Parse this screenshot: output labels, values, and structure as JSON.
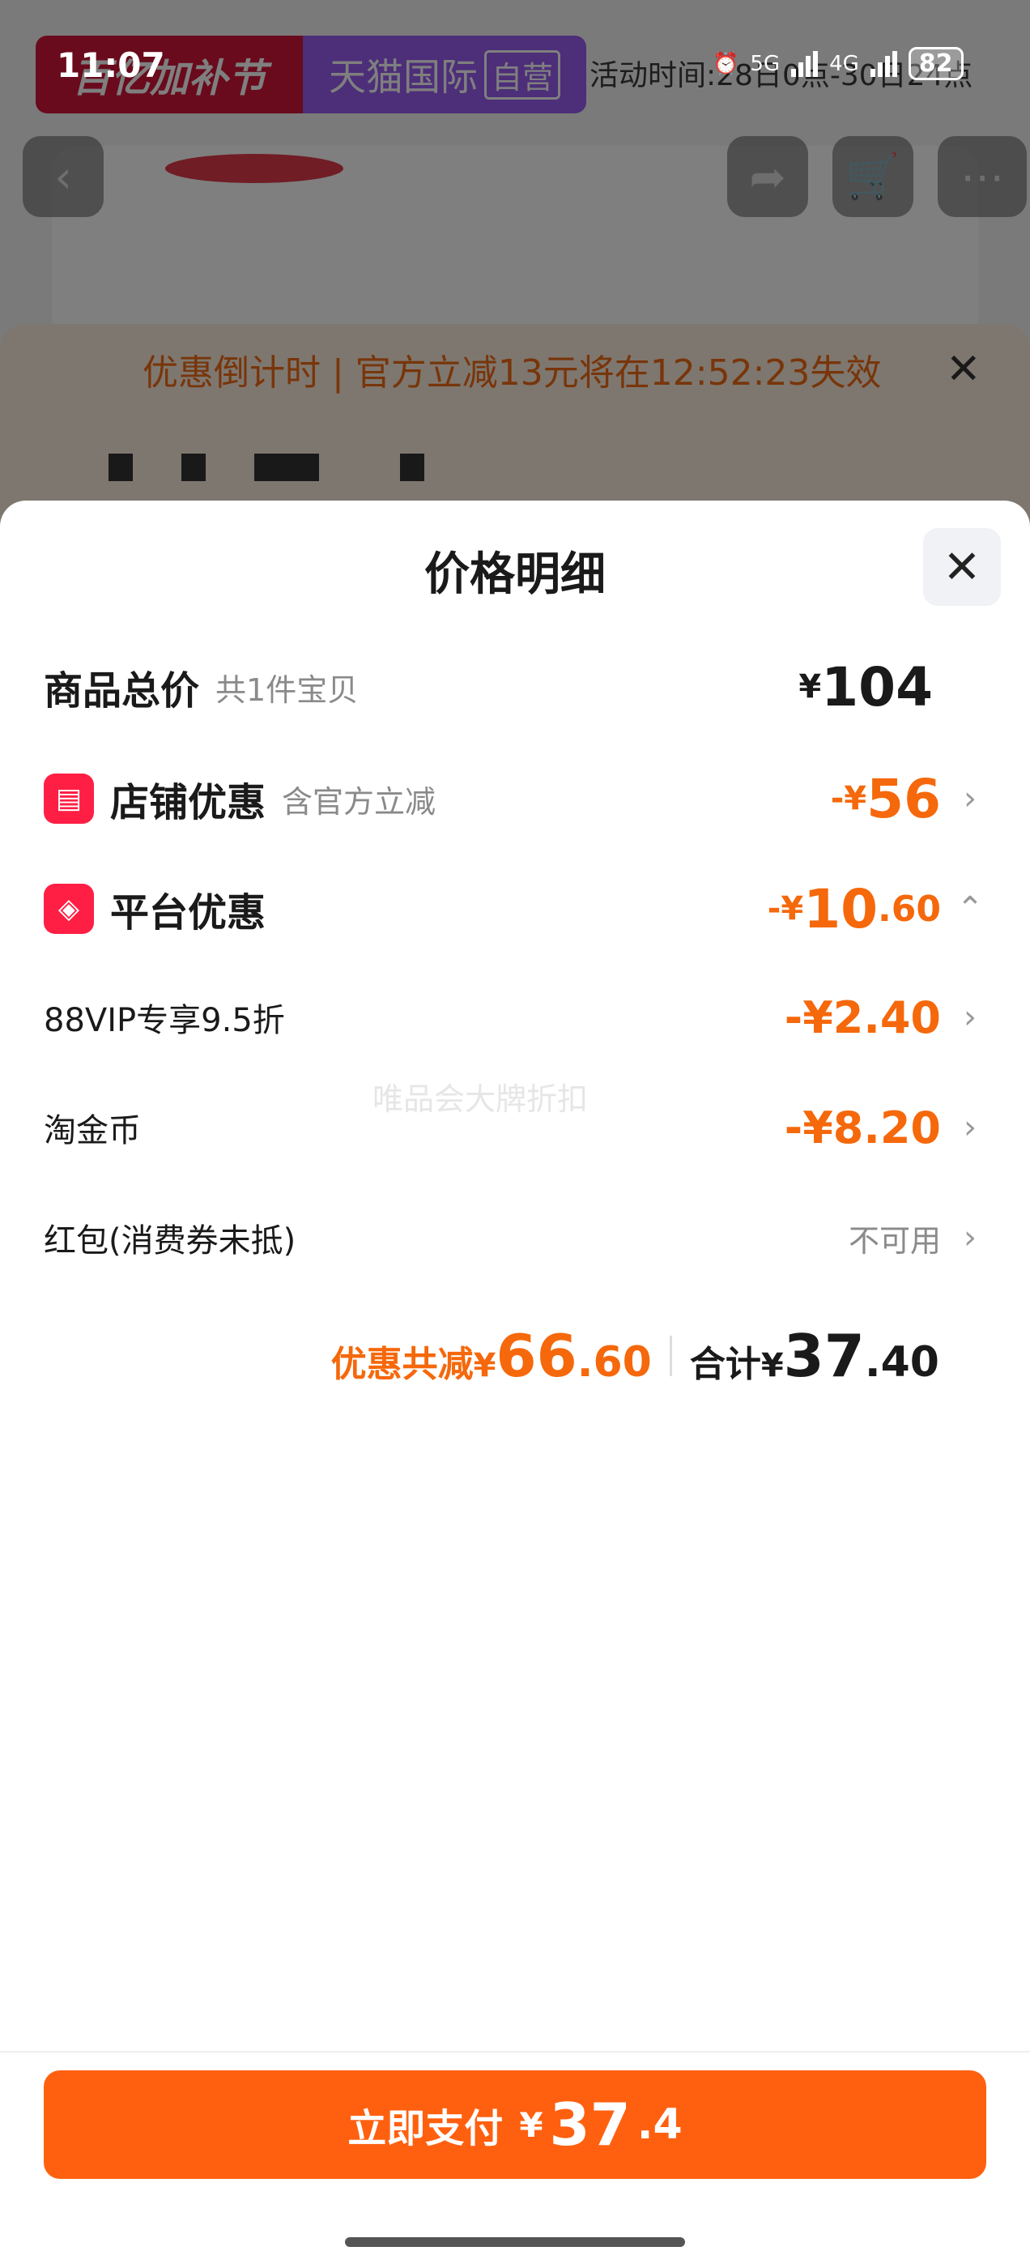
{
  "status_bar": {
    "time": "11:07",
    "network_1": "5G",
    "network_2": "4G",
    "battery": "82"
  },
  "background_page": {
    "promo_left": "百亿加补节",
    "promo_right": "天猫国际",
    "promo_badge": "自营",
    "promo_time": "活动时间:28日0点-30日24点",
    "countdown": "优惠倒计时 | 官方立减13元将在12:52:23失效",
    "tag": "铂金铸"
  },
  "sheet": {
    "title": "价格明细",
    "rows": {
      "total": {
        "label": "商品总价",
        "sub": "共1件宝贝",
        "yen": "¥",
        "amount": "104"
      },
      "shop": {
        "label": "店铺优惠",
        "sub": "含官方立减",
        "prefix": "-¥",
        "amount": "56"
      },
      "platform": {
        "label": "平台优惠",
        "prefix": "-¥",
        "amount": "10",
        "decimal": ".60"
      },
      "vip": {
        "label": "88VIP专享9.5折",
        "amount": "-¥2.40"
      },
      "coin": {
        "label": "淘金币",
        "amount": "-¥8.20"
      },
      "redpacket": {
        "label": "红包(消费券未抵)",
        "status": "不可用"
      }
    },
    "watermark": "唯品会大牌折扣",
    "summary": {
      "discount_label": "优惠共减",
      "discount_yen": "¥",
      "discount_int": "66",
      "discount_dec": ".60",
      "total_label": "合计",
      "total_yen": "¥",
      "total_int": "37",
      "total_dec": ".40"
    }
  },
  "pay_button": {
    "label": "立即支付",
    "yen": "¥",
    "amount_int": "37",
    "amount_dec": ".4"
  },
  "colors": {
    "accent_orange": "#f5680b",
    "pay_button": "#ff6010",
    "icon_red": "#ff1f44"
  }
}
